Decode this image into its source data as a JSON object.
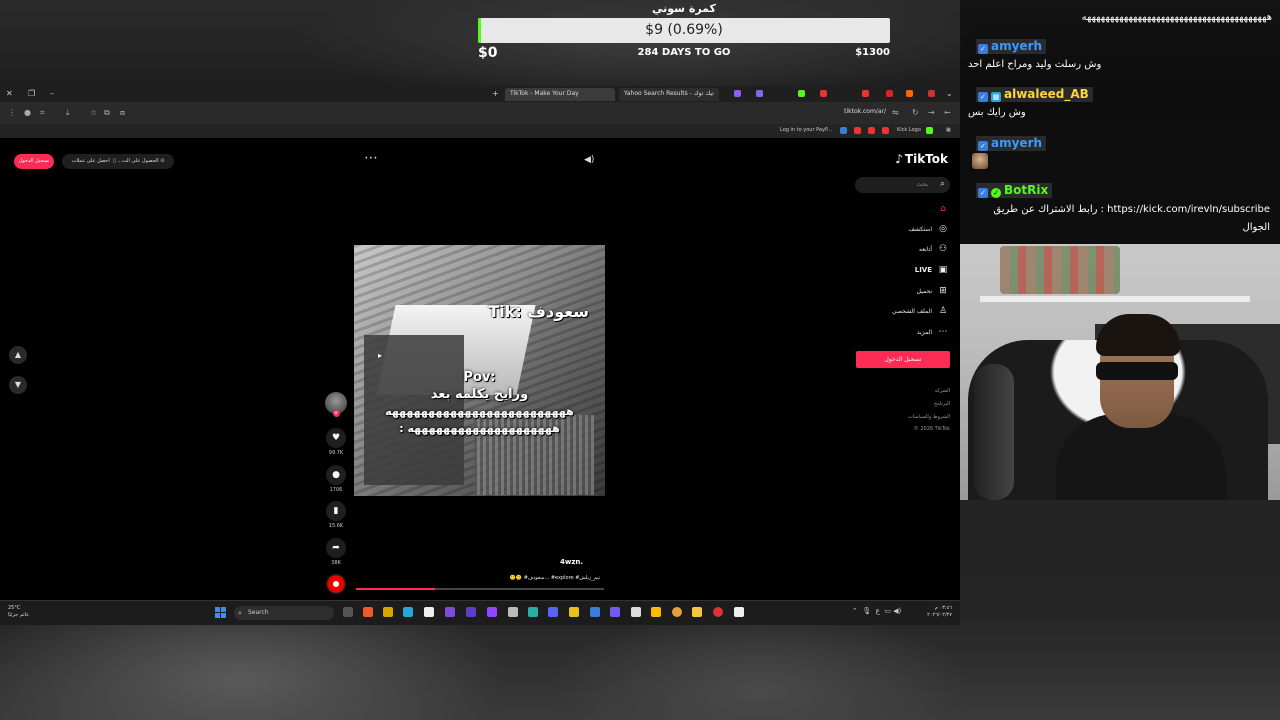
{
  "goal": {
    "title": "كمرة سوني",
    "amount_label": "$9 (0.69%)",
    "progress_percent": 0.69,
    "min_label": "$0",
    "days_label": "284 DAYS TO GO",
    "max_label": "$1300",
    "fill_color": "#53fc18"
  },
  "browser": {
    "tabs": [
      {
        "label": "TikTok - Make Your Day",
        "active": true
      },
      {
        "label": "Yahoo Search Results - تيك توك",
        "active": false
      }
    ],
    "url": "tiktok.com/ar/",
    "bookmarks": [
      "Log in to your PayP...",
      "Kick Logo"
    ]
  },
  "tiktok": {
    "login_pill": "تسجيل الدخول",
    "app_pill_1": "الحصول على الت...",
    "app_pill_2": "احصل على عملات",
    "logo": "TikTok",
    "search_placeholder": "بحث",
    "nav": [
      {
        "label": "",
        "icon": "home-icon",
        "glyph": "⌂"
      },
      {
        "label": "استكشف",
        "icon": "compass-icon",
        "glyph": "◎"
      },
      {
        "label": "أتابعه",
        "icon": "following-icon",
        "glyph": "⚇"
      },
      {
        "label": "LIVE",
        "icon": "live-icon",
        "glyph": "▣"
      },
      {
        "label": "تحميل",
        "icon": "upload-icon",
        "glyph": "⊞"
      },
      {
        "label": "الملف الشخصي",
        "icon": "profile-icon",
        "glyph": "♙"
      },
      {
        "label": "المزيد",
        "icon": "more-icon",
        "glyph": "⋯"
      }
    ],
    "login_button": "تسجيل الدخول",
    "footer": [
      "الشركة",
      "البرنامج",
      "الشروط والسياسات",
      "© 2026 TikTok"
    ],
    "video": {
      "tag": "Tik: سعودف",
      "caption_line1": "Pov:",
      "caption_line2": "ورايح يكلمه بعد",
      "caption_line3": "هههههههههههههههههههههههههه",
      "caption_line4": ": ههههههههههههههههههههه",
      "progress_percent": 32
    },
    "actions": {
      "likes": "99.7K",
      "comments": "1706",
      "saves": "15.6K",
      "shares": "38K"
    },
    "author": "4wzn.",
    "description": "🙂🙂 #سعودف... #explore #تيم_ريلش"
  },
  "taskbar": {
    "weather_temp": "25°C",
    "weather_desc": "غائم جزئيًا",
    "search_label": "Search",
    "time": "٠٣:٤٦ م",
    "date": "٢٠٢٦/٠٢/٢٧",
    "lang": "ع"
  },
  "chat": {
    "top_message": "ههههههههههههههههههههههههههههههههههههههههه",
    "messages": [
      {
        "user": "amyerh",
        "text": "وش رسلت وليد ومراح اعلم احد",
        "user_color": "#3a9bff"
      },
      {
        "user": "alwaleed_AB",
        "text": "وش رايك بس",
        "user_color": "#ffd53a"
      },
      {
        "user": "amyerh",
        "text": "",
        "user_color": "#3a9bff"
      },
      {
        "user": "BotRix",
        "text": "https://kick.com/irevln/subscribe : رابط الاشتراك عن طريق الجوال",
        "user_color": "#53fc18"
      }
    ]
  }
}
